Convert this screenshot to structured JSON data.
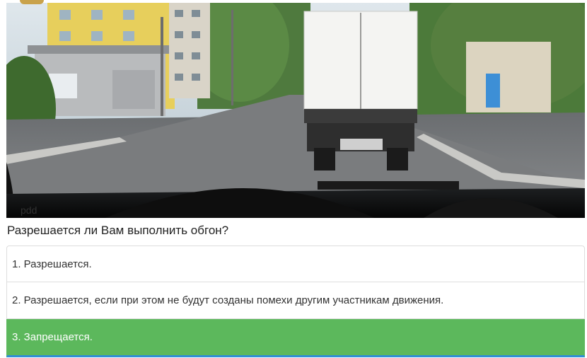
{
  "question": {
    "text": "Разрешается ли Вам выполнить обгон?"
  },
  "answers": [
    {
      "label": "1. Разрешается.",
      "state": "default"
    },
    {
      "label": "2. Разрешается, если при этом не будут созданы помехи другим участникам движения.",
      "state": "default"
    },
    {
      "label": "3. Запрещается.",
      "state": "correct"
    }
  ],
  "photo": {
    "watermark": "pdd"
  },
  "colors": {
    "correct_bg": "#5cb85c",
    "correct_border": "#2f8fd6",
    "answer_border": "#dddddd",
    "text": "#333333"
  }
}
